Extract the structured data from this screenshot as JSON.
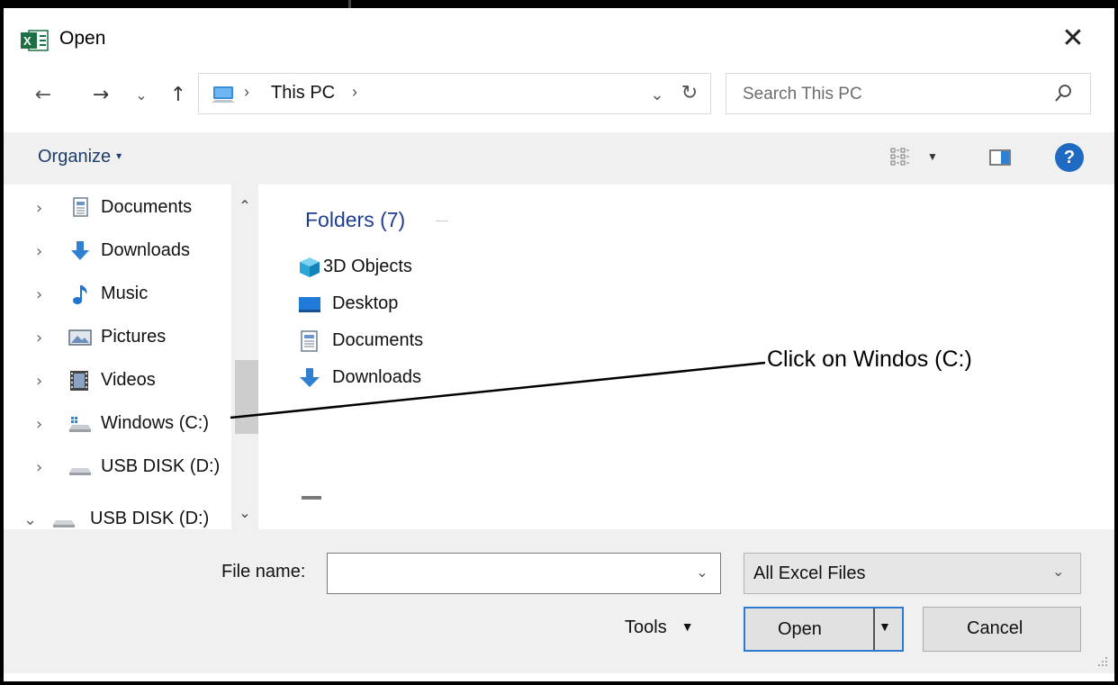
{
  "window": {
    "title": "Open",
    "app_icon": "excel-icon",
    "close_glyph": "✕"
  },
  "nav": {
    "back_glyph": "←",
    "forward_glyph": "→",
    "recent_glyph": "⌄",
    "up_glyph": "↑",
    "separator": "›",
    "crumb": "This PC",
    "dropdown_glyph": "⌄",
    "refresh_glyph": "↻"
  },
  "search": {
    "placeholder": "Search This PC"
  },
  "toolbar": {
    "organize_label": "Organize",
    "organize_caret": "▾",
    "view_dd": "▼",
    "help_label": "?"
  },
  "sidebar": {
    "items": [
      {
        "label": "Documents",
        "icon": "documents-icon"
      },
      {
        "label": "Downloads",
        "icon": "downloads-icon"
      },
      {
        "label": "Music",
        "icon": "music-icon"
      },
      {
        "label": "Pictures",
        "icon": "pictures-icon"
      },
      {
        "label": "Videos",
        "icon": "videos-icon"
      },
      {
        "label": "Windows (C:)",
        "icon": "drive-c-icon"
      },
      {
        "label": "USB DISK (D:)",
        "icon": "usb-drive-icon"
      },
      {
        "label": "USB DISK (D:)",
        "icon": "usb-drive-icon",
        "expanded": true
      }
    ],
    "collapsed_chevron": "›",
    "expanded_chevron": "⌄",
    "scroll_up": "⌃",
    "scroll_down": "⌄"
  },
  "content": {
    "group_header": "Folders (7)",
    "items": [
      {
        "label": "3D Objects",
        "icon": "3d-objects-icon"
      },
      {
        "label": "Desktop",
        "icon": "desktop-icon"
      },
      {
        "label": "Documents",
        "icon": "documents-icon"
      },
      {
        "label": "Downloads",
        "icon": "downloads-icon"
      }
    ]
  },
  "annotation": {
    "text": "Click on Windos (C:)"
  },
  "bottom": {
    "file_name_label": "File name:",
    "file_name_value": "",
    "file_name_dd": "⌄",
    "filter_value": "All Excel Files",
    "filter_dd": "⌄",
    "tools_label": "Tools",
    "tools_caret": "▼",
    "open_label": "Open",
    "open_arrow": "▼",
    "cancel_label": "Cancel"
  },
  "colors": {
    "accent_blue": "#2e7ad0",
    "link_blue": "#1e3d8f",
    "toolbar_bg": "#f0f0f0",
    "excel_green": "#1d7044"
  }
}
